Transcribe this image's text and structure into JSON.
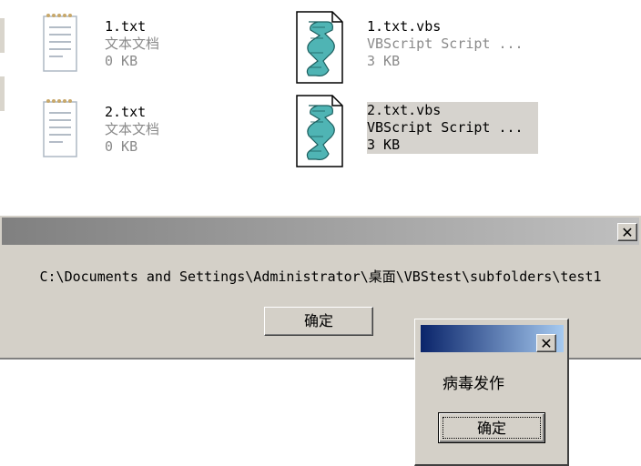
{
  "files": [
    {
      "name": "1.txt",
      "type": "文本文档",
      "size": "0 KB",
      "icon": "text-document-icon"
    },
    {
      "name": "1.txt.vbs",
      "type": "VBScript Script ...",
      "size": "3 KB",
      "icon": "vbscript-icon"
    },
    {
      "name": "2.txt",
      "type": "文本文档",
      "size": "0 KB",
      "icon": "text-document-icon"
    },
    {
      "name": "2.txt.vbs",
      "type": "VBScript Script ...",
      "size": "3 KB",
      "icon": "vbscript-icon"
    }
  ],
  "main_dialog": {
    "close_symbol": "✕",
    "message": "C:\\Documents and Settings\\Administrator\\桌面\\VBStest\\subfolders\\test1",
    "ok_label": "确定"
  },
  "virus_dialog": {
    "close_symbol": "✕",
    "message": "病毒发作",
    "ok_label": "确定"
  },
  "colors": {
    "dialog_face": "#d4d0c8",
    "active_title_start": "#0a246a",
    "active_title_end": "#a6caf0",
    "inactive_title_start": "#808080"
  }
}
